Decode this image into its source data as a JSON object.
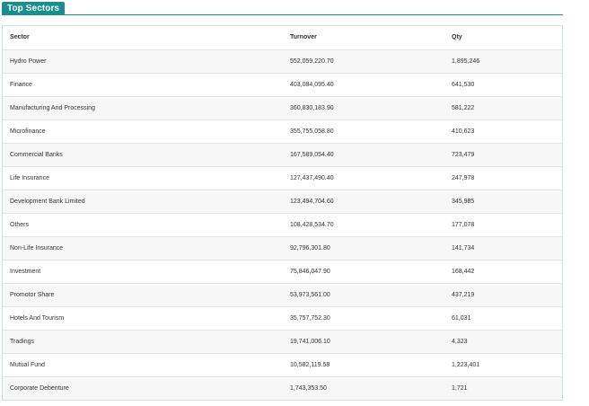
{
  "widget": {
    "tab_label": "Top Sectors",
    "accent_color": "#1a8e8e"
  },
  "table": {
    "headers": [
      "Sector",
      "Turnover",
      "Qty"
    ],
    "rows": [
      {
        "sector": "Hydro Power",
        "turnover": "552,059,220.70",
        "qty": "1,895,246"
      },
      {
        "sector": "Finance",
        "turnover": "403,084,095.40",
        "qty": "641,530"
      },
      {
        "sector": "Manufacturing And Processing",
        "turnover": "360,830,183.90",
        "qty": "581,222"
      },
      {
        "sector": "Microfinance",
        "turnover": "355,755,058.80",
        "qty": "410,623"
      },
      {
        "sector": "Commercial Banks",
        "turnover": "167,589,054.40",
        "qty": "723,479"
      },
      {
        "sector": "Life Insurance",
        "turnover": "127,437,490.40",
        "qty": "247,978"
      },
      {
        "sector": "Development Bank Limited",
        "turnover": "123,494,704.60",
        "qty": "345,985"
      },
      {
        "sector": "Others",
        "turnover": "108,428,534.70",
        "qty": "177,078"
      },
      {
        "sector": "Non-Life Insurance",
        "turnover": "92,796,301.80",
        "qty": "141,734"
      },
      {
        "sector": "Investment",
        "turnover": "75,846,047.90",
        "qty": "168,442"
      },
      {
        "sector": "Promotor Share",
        "turnover": "53,973,561.00",
        "qty": "437,219"
      },
      {
        "sector": "Hotels And Tourism",
        "turnover": "35,757,752.30",
        "qty": "61,031"
      },
      {
        "sector": "Tradings",
        "turnover": "19,741,006.10",
        "qty": "4,323"
      },
      {
        "sector": "Mutual Fund",
        "turnover": "10,582,119.58",
        "qty": "1,223,401"
      },
      {
        "sector": "Corporate Debenture",
        "turnover": "1,743,353.50",
        "qty": "1,721"
      }
    ]
  }
}
